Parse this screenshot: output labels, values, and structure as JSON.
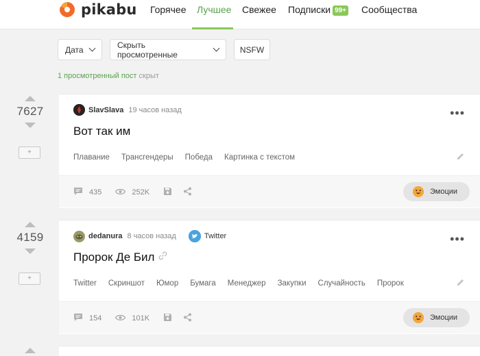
{
  "header": {
    "logo_text": "pikabu",
    "nav": [
      {
        "label": "Горячее"
      },
      {
        "label": "Лучшее",
        "active": true
      },
      {
        "label": "Свежее"
      },
      {
        "label": "Подписки",
        "badge": "99+"
      },
      {
        "label": "Сообщества"
      }
    ]
  },
  "filters": {
    "date": "Дата",
    "hide_seen": "Скрыть просмотренные",
    "nsfw": "NSFW"
  },
  "hidden_note": {
    "highlight": "1 просмотренный пост",
    "rest": " скрыт"
  },
  "stories": [
    {
      "rating": "7627",
      "save": "+",
      "author": "SlavSlava",
      "time": "19 часов назад",
      "title": "Вот так им",
      "tags": [
        "Плавание",
        "Трансгендеры",
        "Победа",
        "Картинка с текстом"
      ],
      "comments": "435",
      "views": "252K",
      "emotions_label": "Эмоции"
    },
    {
      "rating": "4159",
      "save": "+",
      "author": "dedanura",
      "time": "8 часов назад",
      "community": "Twitter",
      "title": "Пророк Де Бил",
      "tags": [
        "Twitter",
        "Скриншот",
        "Юмор",
        "Бумага",
        "Менеджер",
        "Закупки",
        "Случайность",
        "Пророк"
      ],
      "comments": "154",
      "views": "101K",
      "emotions_label": "Эмоции"
    }
  ],
  "colors": {
    "accent": "#8ac858",
    "active_text": "#59a24d",
    "twitter": "#4aa3df",
    "logo_orange": "#f26b2a"
  }
}
